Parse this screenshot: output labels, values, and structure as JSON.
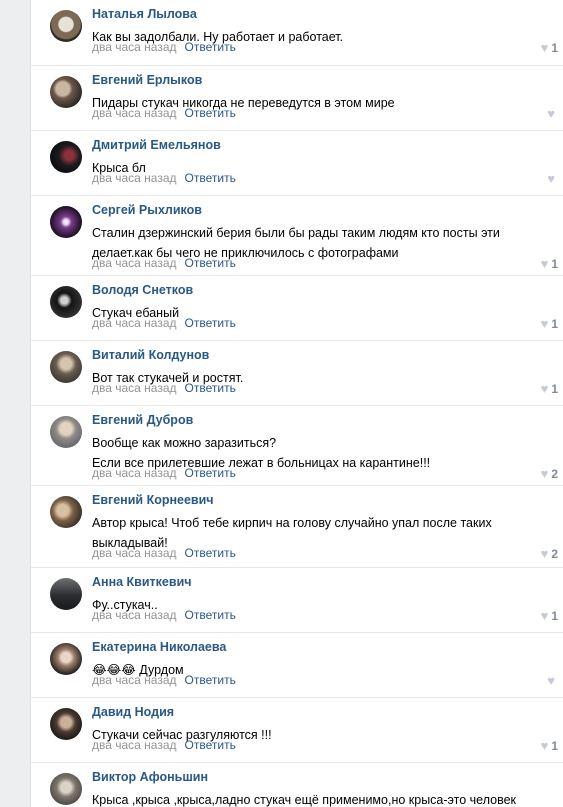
{
  "reply_label": "Ответить",
  "comments": [
    {
      "author": "Наталья Лылова",
      "text": "Как вы задолбали. Ну работает и работает.",
      "time": "два часа назад",
      "likes": "1"
    },
    {
      "author": "Евгений Ерлыков",
      "text": "Пидары стукач никогда не переведутся в этом мире",
      "time": "два часа назад",
      "likes": ""
    },
    {
      "author": "Дмитрий Емельянов",
      "text": "Крыса бл",
      "time": "два часа назад",
      "likes": ""
    },
    {
      "author": "Сергей Рыхликов",
      "text": "Сталин дзержинский берия были бы рады таким людям кто посты эти\nделает.как бы чего не приключилось с фотографами",
      "time": "два часа назад",
      "likes": "1"
    },
    {
      "author": "Володя Снетков",
      "text": "Стукач ебаный",
      "time": "два часа назад",
      "likes": "1"
    },
    {
      "author": "Виталий Колдунов",
      "text": "Вот так стукачей и ростят.",
      "time": "два часа назад",
      "likes": "1"
    },
    {
      "author": "Евгений Дубров",
      "text": "Вообще как можно заразиться?\nЕсли все прилетевшие лежат в больницах на карантине!!!",
      "time": "два часа назад",
      "likes": "2"
    },
    {
      "author": "Евгений Корнеевич",
      "text": "Автор крыса! Чтоб тебе кирпич на голову случайно упал после таких\nвыкладывай!",
      "time": "два часа назад",
      "likes": "2"
    },
    {
      "author": "Анна Квиткевич",
      "text": "Фу..стукач..",
      "time": "два часа назад",
      "likes": "1"
    },
    {
      "author": "Екатерина Николаева",
      "text": "😂😂😂 Дурдом",
      "time": "два часа назад",
      "likes": ""
    },
    {
      "author": "Давид Нодия",
      "text": "Стукачи сейчас разгуляются !!!",
      "time": "два часа назад",
      "likes": "1"
    },
    {
      "author": "Виктор Афоньшин",
      "text": "Крыса ,крыса ,крыса,ладно стукач ещё применимо,но крыса-это человек\nворующий у своих,ну при чем тут 🤔",
      "time": "",
      "likes": ""
    }
  ]
}
